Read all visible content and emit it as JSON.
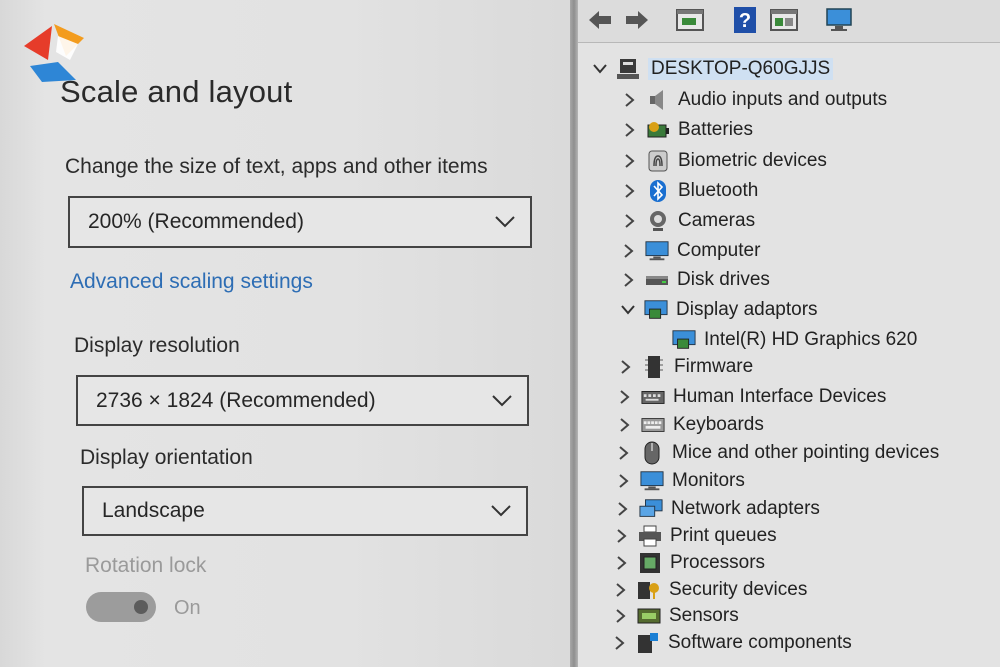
{
  "settings": {
    "title": "Scale and layout",
    "scale_label": "Change the size of text, apps and other items",
    "scale_value": "200% (Recommended)",
    "advanced_link": "Advanced scaling settings",
    "resolution_label": "Display resolution",
    "resolution_value": "2736 × 1824 (Recommended)",
    "orientation_label": "Display orientation",
    "orientation_value": "Landscape",
    "rotation_lock_label": "Rotation lock",
    "rotation_lock_state": "On"
  },
  "device_manager": {
    "toolbar": [
      "back-arrow-icon",
      "forward-arrow-icon",
      "properties-icon",
      "help-icon",
      "update-driver-icon",
      "scan-hardware-icon"
    ],
    "root": "DESKTOP-Q60GJJS",
    "categories": [
      {
        "label": "Audio inputs and outputs",
        "icon": "speaker-icon",
        "expanded": false
      },
      {
        "label": "Batteries",
        "icon": "battery-icon",
        "expanded": false
      },
      {
        "label": "Biometric devices",
        "icon": "fingerprint-icon",
        "expanded": false
      },
      {
        "label": "Bluetooth",
        "icon": "bluetooth-icon",
        "expanded": false
      },
      {
        "label": "Cameras",
        "icon": "camera-icon",
        "expanded": false
      },
      {
        "label": "Computer",
        "icon": "computer-icon",
        "expanded": false
      },
      {
        "label": "Disk drives",
        "icon": "disk-drive-icon",
        "expanded": false
      },
      {
        "label": "Display adaptors",
        "icon": "display-adapter-icon",
        "expanded": true,
        "children": [
          {
            "label": "Intel(R) HD Graphics 620",
            "icon": "display-adapter-icon"
          }
        ]
      },
      {
        "label": "Firmware",
        "icon": "firmware-icon",
        "expanded": false
      },
      {
        "label": "Human Interface Devices",
        "icon": "hid-icon",
        "expanded": false
      },
      {
        "label": "Keyboards",
        "icon": "keyboard-icon",
        "expanded": false
      },
      {
        "label": "Mice and other pointing devices",
        "icon": "mouse-icon",
        "expanded": false
      },
      {
        "label": "Monitors",
        "icon": "monitor-icon",
        "expanded": false
      },
      {
        "label": "Network adapters",
        "icon": "network-adapter-icon",
        "expanded": false
      },
      {
        "label": "Print queues",
        "icon": "printer-icon",
        "expanded": false
      },
      {
        "label": "Processors",
        "icon": "processor-icon",
        "expanded": false
      },
      {
        "label": "Security devices",
        "icon": "security-device-icon",
        "expanded": false
      },
      {
        "label": "Sensors",
        "icon": "sensor-icon",
        "expanded": false
      },
      {
        "label": "Software components",
        "icon": "software-component-icon",
        "expanded": false
      }
    ]
  },
  "colors": {
    "link": "#2d6db4",
    "selection": "#cfe0f2",
    "accent": "#1a7fd4"
  }
}
